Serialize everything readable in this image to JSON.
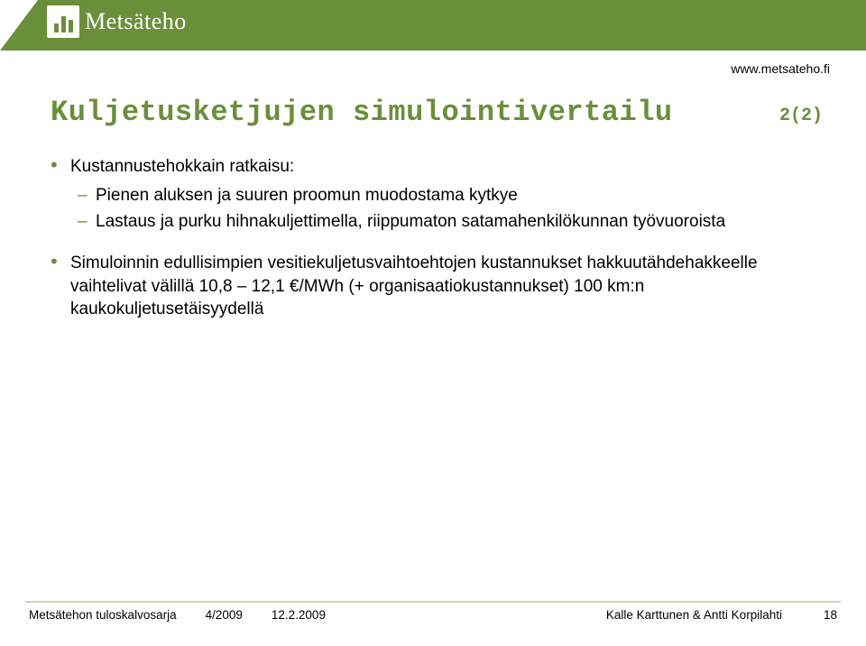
{
  "header": {
    "brand": "Metsäteho",
    "url": "www.metsateho.fi"
  },
  "title": "Kuljetusketjujen simulointivertailu",
  "pageIndicator": "2(2)",
  "content": {
    "top": {
      "label": "Kustannustehokkain ratkaisu:",
      "items": [
        "Pienen aluksen ja suuren proomun muodostama kytkye",
        "Lastaus ja purku hihnakuljettimella, riippumaton satamahenkilökunnan työvuoroista"
      ]
    },
    "second": "Simuloinnin edullisimpien vesitiekuljetusvaihtoehtojen kustannukset hakkuutähdehakkeelle vaihtelivat välillä 10,8 – 12,1 €/MWh (+ organisaatiokustannukset) 100 km:n kaukokuljetusetäisyydellä"
  },
  "footer": {
    "series": "Metsätehon tuloskalvosarja",
    "issue": "4/2009",
    "date": "12.2.2009",
    "authors": "Kalle Karttunen & Antti Korpilahti",
    "pageNumber": "18"
  }
}
